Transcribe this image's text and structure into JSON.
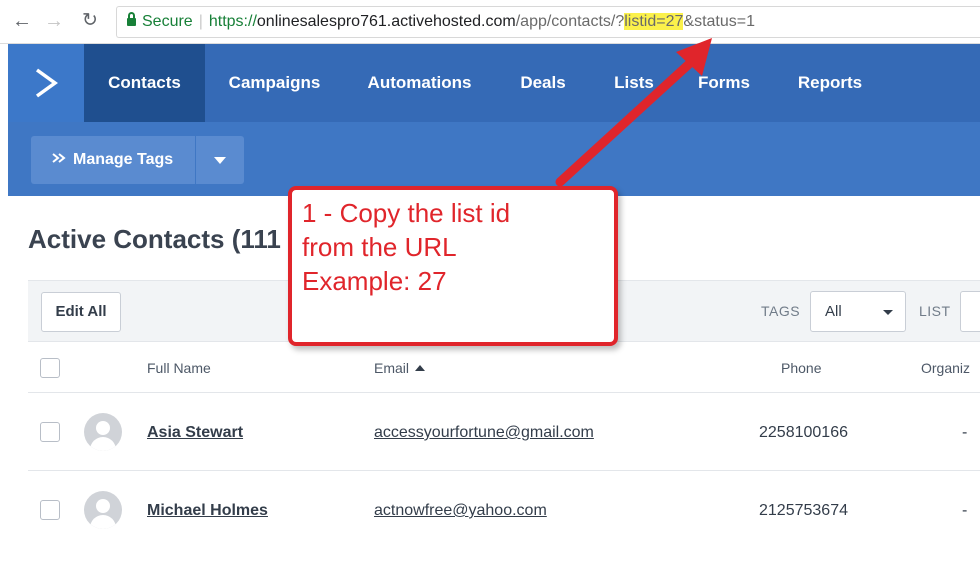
{
  "browser": {
    "secure_label": "Secure",
    "url_scheme": "https://",
    "url_host": "onlinesalespro761.activehosted.com",
    "url_path": "/app/contacts/?",
    "url_highlight": "listid=27",
    "url_rest": "&status=1"
  },
  "nav": {
    "items": [
      {
        "label": "Contacts",
        "active": true
      },
      {
        "label": "Campaigns"
      },
      {
        "label": "Automations"
      },
      {
        "label": "Deals"
      },
      {
        "label": "Lists"
      },
      {
        "label": "Forms"
      },
      {
        "label": "Reports"
      }
    ]
  },
  "toolbar": {
    "manage_tags_label": "Manage Tags"
  },
  "page": {
    "title": "Active Contacts (111"
  },
  "filters": {
    "edit_all_label": "Edit All",
    "tags_label": "TAGS",
    "tags_value": "All",
    "list_label": "LIST"
  },
  "table": {
    "headers": {
      "full_name": "Full Name",
      "email": "Email",
      "phone": "Phone",
      "organization": "Organiz"
    },
    "rows": [
      {
        "name": "Asia Stewart",
        "email": "accessyourfortune@gmail.com",
        "phone": "2258100166",
        "org": "-"
      },
      {
        "name": "Michael Holmes",
        "email": "actnowfree@yahoo.com",
        "phone": "2125753674",
        "org": "-"
      }
    ]
  },
  "annotation": {
    "line1": "1 - Copy the list id",
    "line2": "from the URL",
    "line3": "Example: 27"
  },
  "colors": {
    "nav_bg": "#356ab6",
    "nav_active": "#1f4f8f",
    "toolbar_bg": "#3f77c4",
    "annotation_red": "#e0252b",
    "url_highlight": "#fbf14b"
  }
}
